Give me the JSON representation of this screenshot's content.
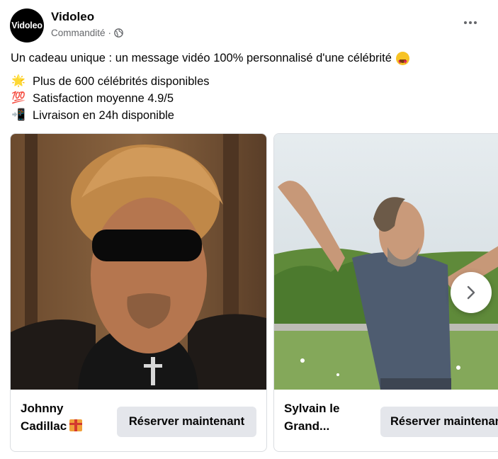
{
  "header": {
    "avatar_text": "Vidoleo",
    "page_name": "Vidoleo",
    "sponsored_label": "Commandité",
    "separator": "·"
  },
  "post": {
    "intro": "Un cadeau unique : un message vidéo 100% personnalisé d'une célébrité",
    "bullets": [
      {
        "icon": "sparkle-star-emoji",
        "glyph": "🌟",
        "text": "Plus de 600 célébrités disponibles"
      },
      {
        "icon": "hundred-points-emoji",
        "glyph": "💯",
        "text": "Satisfaction moyenne 4.9/5"
      },
      {
        "icon": "mobile-arrow-emoji",
        "glyph": "📲",
        "text": "Livraison en 24h disponible"
      }
    ]
  },
  "carousel": {
    "cards": [
      {
        "title_line1": "Johnny",
        "title_line2": "Cadillac",
        "cta": "Réserver maintenant"
      },
      {
        "title_line1": "Sylvain le",
        "title_line2": "Grand...",
        "cta": "Réserver maintenant"
      }
    ]
  },
  "colors": {
    "text": "#050505",
    "secondary_text": "#65676b",
    "button_bg": "#e4e6eb",
    "card_border": "#dadde1"
  }
}
